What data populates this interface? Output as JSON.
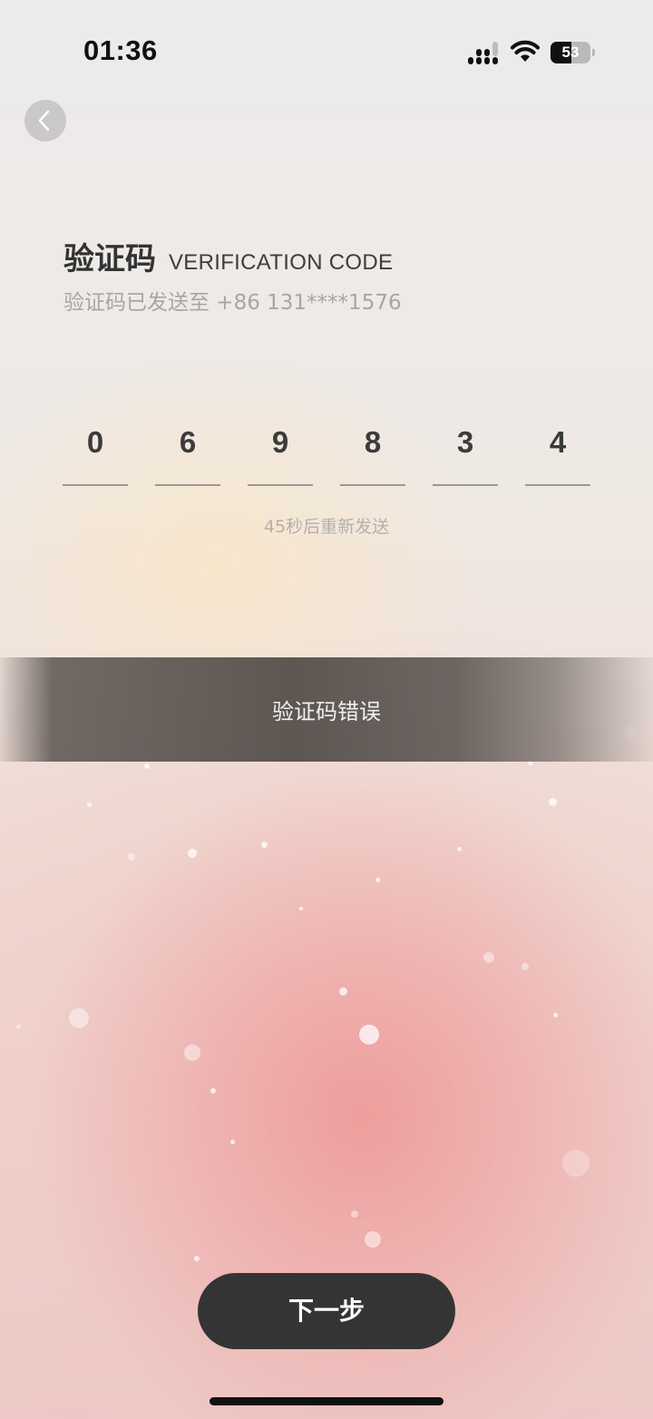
{
  "status_bar": {
    "time": "01:36",
    "signal_icon": "cellular-signal-icon",
    "wifi_icon": "wifi-icon",
    "battery_level": "53",
    "battery_percent": 53
  },
  "nav": {
    "back_icon": "chevron-left-icon"
  },
  "header": {
    "title_cn": "验证码",
    "title_en": "VERIFICATION CODE",
    "subtitle": "验证码已发送至 +86 131****1576"
  },
  "code": {
    "digits": [
      "0",
      "6",
      "9",
      "8",
      "3",
      "4"
    ]
  },
  "resend": {
    "text": "45秒后重新发送"
  },
  "toast": {
    "message": "验证码错误"
  },
  "actions": {
    "next_label": "下一步"
  },
  "colors": {
    "primary_button": "#353434",
    "toast_bg": "#554f4b",
    "muted_text": "#a8a6a5"
  }
}
